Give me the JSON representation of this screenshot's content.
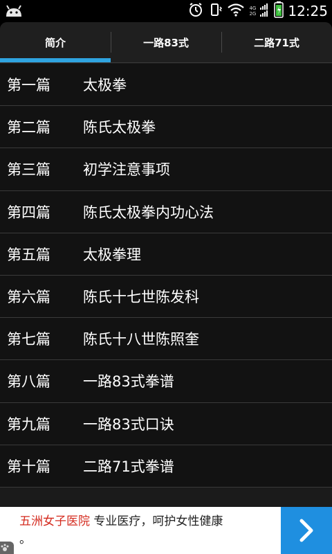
{
  "status_bar": {
    "time": "12:25",
    "network_top": "4G",
    "network_bottom": "2G"
  },
  "tabs": [
    {
      "label": "简介",
      "active": true
    },
    {
      "label": "一路83式",
      "active": false
    },
    {
      "label": "二路71式",
      "active": false
    }
  ],
  "chapters": [
    {
      "num": "第一篇",
      "title": "太极拳"
    },
    {
      "num": "第二篇",
      "title": "陈氏太极拳"
    },
    {
      "num": "第三篇",
      "title": "初学注意事项"
    },
    {
      "num": "第四篇",
      "title": "陈氏太极拳内功心法"
    },
    {
      "num": "第五篇",
      "title": "太极拳理"
    },
    {
      "num": "第六篇",
      "title": "陈氏十七世陈发科"
    },
    {
      "num": "第七篇",
      "title": "陈氏十八世陈照奎"
    },
    {
      "num": "第八篇",
      "title": "一路83式拳谱"
    },
    {
      "num": "第九篇",
      "title": "一路83式口诀"
    },
    {
      "num": "第十篇",
      "title": "二路71式拳谱"
    }
  ],
  "ad": {
    "brand": "五洲女子医院",
    "text": " 专业医疗，呵护女性健康",
    "text_line2": "。"
  },
  "colors": {
    "accent": "#2fa4e0",
    "ad_brand": "#d42a1e",
    "ad_button": "#1f8fe0"
  }
}
